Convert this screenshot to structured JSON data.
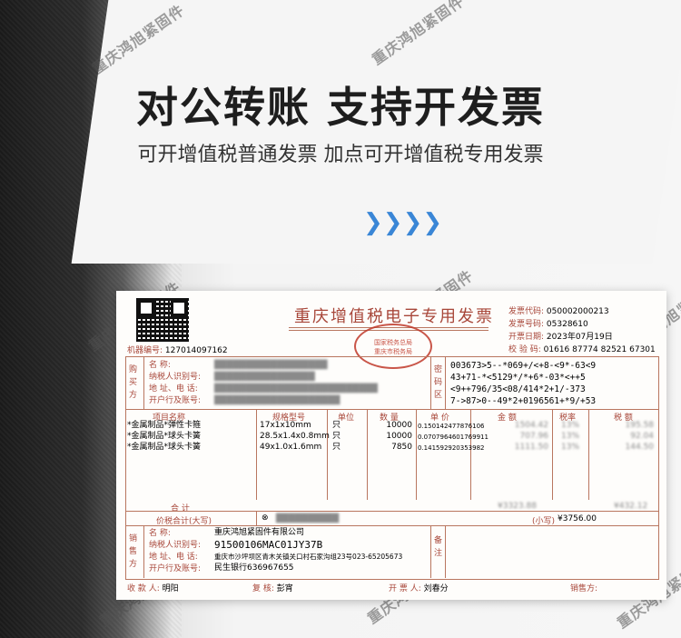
{
  "watermark": "重庆鸿旭紧固件",
  "headline": "对公转账 支持开发票",
  "subheadline": "可开增值税普通发票 加点可开增值税专用发票",
  "chevrons": "❯❯❯❯",
  "invoice": {
    "title": "重庆增值税电子专用发票",
    "code_label": "发票代码:",
    "code": "050002000213",
    "number_label": "发票号码:",
    "number": "05328610",
    "date_label": "开票日期:",
    "date": "2023年07月19日",
    "check_label": "校 验 码:",
    "check": "01616 87774 82521 67301",
    "machine_label": "机器编号:",
    "machine": "127014097162",
    "stamp_line1": "国家税务总局",
    "stamp_line2": "重庆市税务局",
    "buyer_side": "购买方",
    "buyer_name_label": "名        称:",
    "buyer_tax_label": "纳税人识别号:",
    "buyer_addr_label": "地 址、电 话:",
    "buyer_bank_label": "开户行及账号:",
    "cipher_side": "密码区",
    "cipher": [
      "003673>5--*069+/<+8-<9*-63<9",
      "43+71-*<5129*/*+6*-03*<++5",
      "<9++796/35<08/414*2+1/-373",
      "7->87>0--49*2+0196561+*9/+53"
    ],
    "headers": [
      "项目名称",
      "规格型号",
      "单位",
      "数 量",
      "单 价",
      "金 额",
      "税率",
      "税 额"
    ],
    "items": [
      {
        "name": "*金属制品*弹性卡箍",
        "spec": "17x1x10mm",
        "unit": "只",
        "qty": "10000",
        "price": "0.150142477876106",
        "amount": "1504.42",
        "rate": "13%",
        "tax": "195.58"
      },
      {
        "name": "*金属制品*球头卡簧",
        "spec": "28.5x1.4x0.8mm",
        "unit": "只",
        "qty": "10000",
        "price": "0.0707964601769911",
        "amount": "707.96",
        "rate": "13%",
        "tax": "92.04"
      },
      {
        "name": "*金属制品*球头卡簧",
        "spec": "49x1.0x1.6mm",
        "unit": "只",
        "qty": "7850",
        "price": "0.141592920353982",
        "amount": "1111.50",
        "rate": "13%",
        "tax": "144.50"
      }
    ],
    "total_label": "合      计",
    "total_amount": "¥3323.88",
    "total_tax": "¥432.12",
    "grand_label": "价税合计(大写)",
    "grand_small_label": "(小写)",
    "grand_small": "¥3756.00",
    "seller_side": "销售方",
    "seller_name_label": "名        称:",
    "seller_name": "重庆鸿旭紧固件有限公司",
    "seller_tax_label": "纳税人识别号:",
    "seller_tax": "91500106MAC01JY37B",
    "seller_addr_label": "地 址、电 话:",
    "seller_addr": "重庆市沙坪坝区青木关镇关口村石家沟组23号023-65205673",
    "seller_bank_label": "开户行及账号:",
    "seller_bank": "民生银行636967655",
    "remark_side": "备注",
    "payee_label": "收 款 人:",
    "payee": "明阳",
    "reviewer_label": "复 核:",
    "reviewer": "彭宵",
    "issuer_label": "开 票 人:",
    "issuer": "刘春分",
    "seller_footer_label": "销售方:"
  }
}
